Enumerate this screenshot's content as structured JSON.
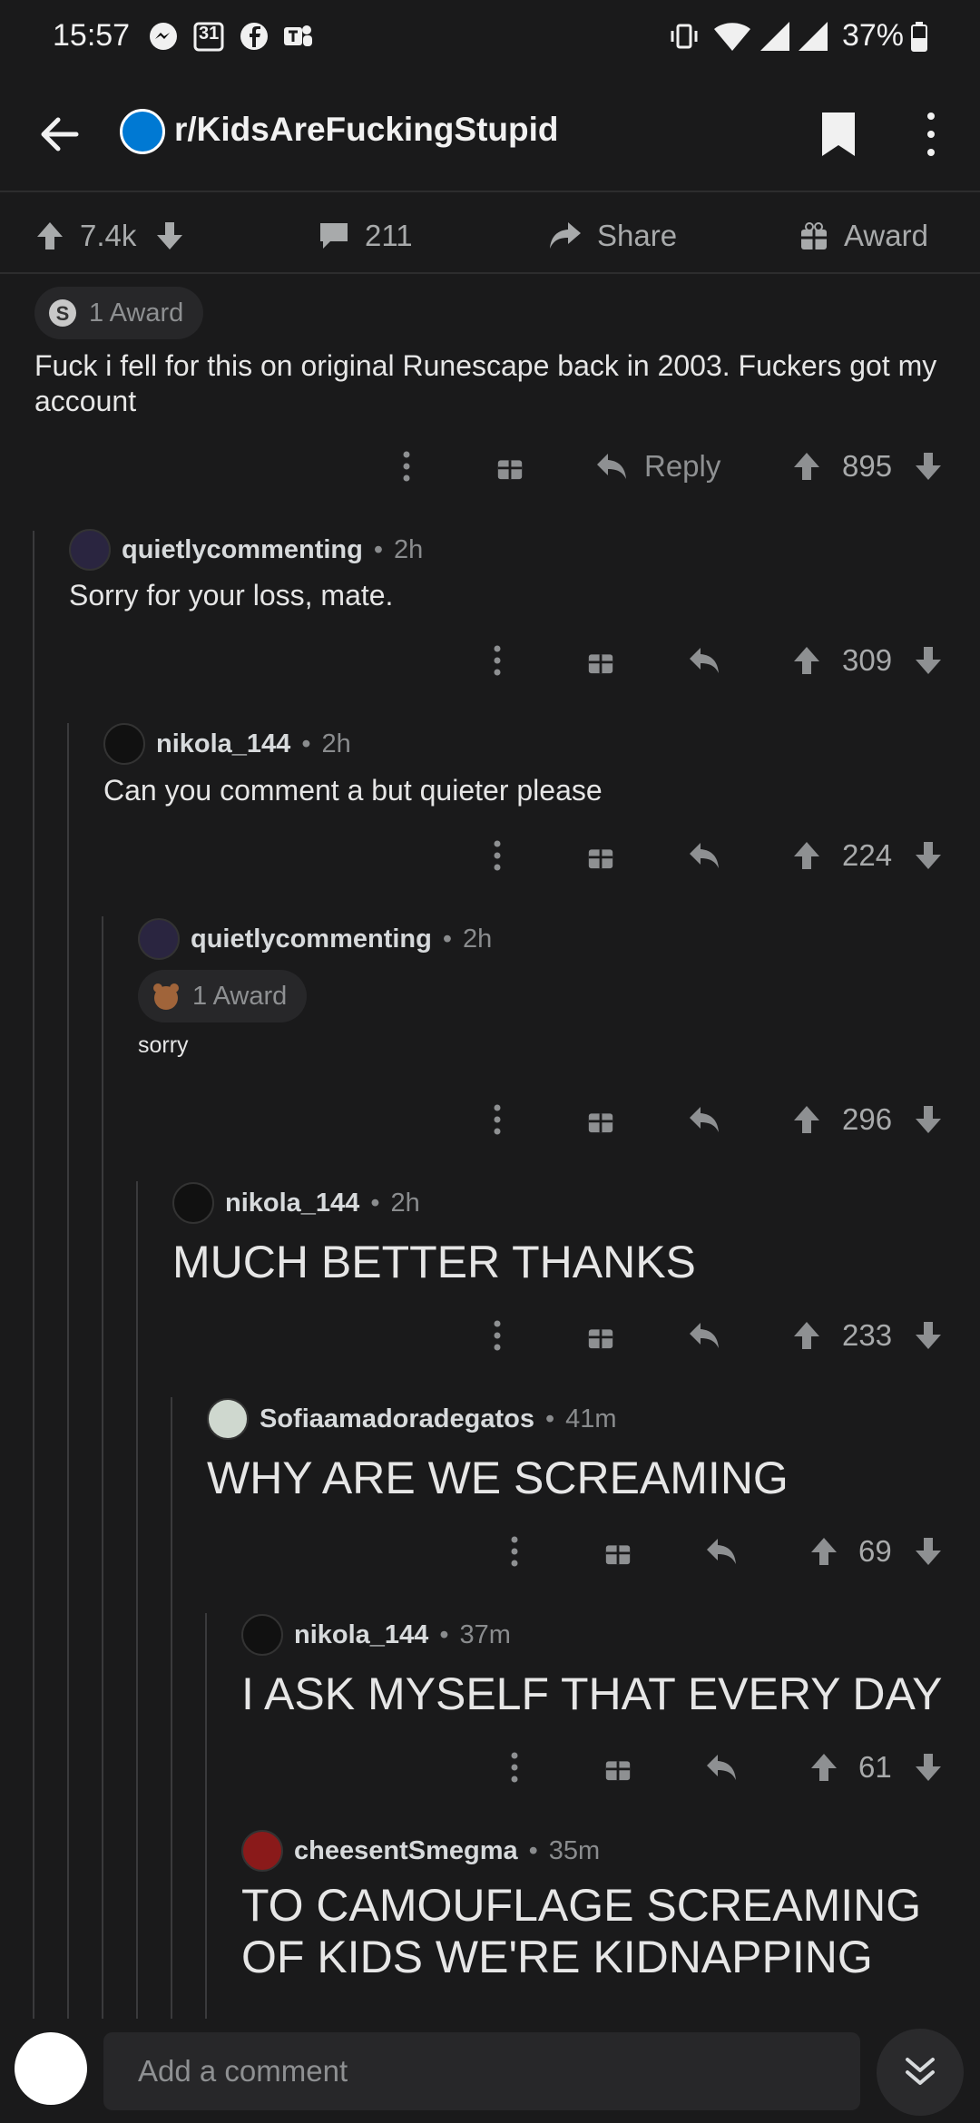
{
  "status_bar": {
    "time": "15:57",
    "battery": "37%",
    "calendar_day": "31"
  },
  "header": {
    "subreddit": "r/KidsAreFuckingStupid"
  },
  "post_actions": {
    "votes": "7.4k",
    "comments": "211",
    "share": "Share",
    "award": "Award"
  },
  "comments": [
    {
      "award": "1 Award",
      "text": "Fuck i fell for this on original Runescape back in 2003. Fuckers got my account",
      "reply_label": "Reply",
      "votes": "895"
    },
    {
      "user": "quietlycommenting",
      "time": "2h",
      "text": "Sorry for your loss, mate.",
      "votes": "309"
    },
    {
      "user": "nikola_144",
      "time": "2h",
      "text": "Can you comment a but quieter please",
      "votes": "224"
    },
    {
      "user": "quietlycommenting",
      "time": "2h",
      "award": "1 Award",
      "text": "sorry",
      "votes": "296"
    },
    {
      "user": "nikola_144",
      "time": "2h",
      "text": "MUCH BETTER THANKS",
      "votes": "233"
    },
    {
      "user": "Sofiaamadoradegatos",
      "time": "41m",
      "text": "WHY ARE WE SCREAMING",
      "votes": "69"
    },
    {
      "user": "nikola_144",
      "time": "37m",
      "text": "I ASK MYSELF THAT EVERY DAY",
      "votes": "61"
    },
    {
      "user": "cheesentSmegma",
      "time": "35m",
      "text": "TO CAMOUFLAGE SCREAMING OF KIDS WE'RE KIDNAPPING"
    }
  ],
  "composer": {
    "placeholder": "Add a comment"
  },
  "colors": {
    "background": "#1a1a1b",
    "text": "#d7dadc",
    "muted": "#8e9092",
    "thread": "#3a3a3c"
  }
}
